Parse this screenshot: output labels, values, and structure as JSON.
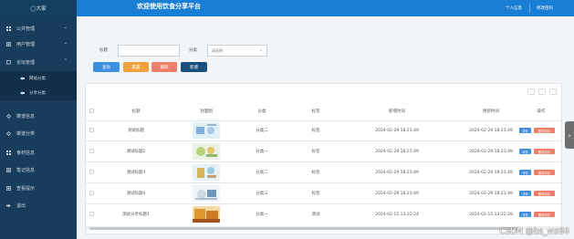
{
  "header": {
    "logo_text": "◯大家",
    "app_title": "欢迎使用饮食分享平台",
    "personal_info": "个人信息",
    "change_password": "修改密码"
  },
  "sidebar": {
    "items": [
      {
        "label": "公共管理",
        "icon": "grid-icon",
        "expanded": false
      },
      {
        "label": "用户管理",
        "icon": "user-icon",
        "expanded": false
      },
      {
        "label": "论坛管理",
        "icon": "forum-icon",
        "expanded": true
      },
      {
        "label": "菜谱信息",
        "icon": "recipe-icon",
        "expanded": false
      },
      {
        "label": "菜谱分类",
        "icon": "category-icon",
        "expanded": false
      },
      {
        "label": "食材信息",
        "icon": "food-icon",
        "expanded": false
      },
      {
        "label": "笔记信息",
        "icon": "note-icon",
        "expanded": false
      },
      {
        "label": "查看提示",
        "icon": "notice-icon",
        "expanded": false
      },
      {
        "label": "退出",
        "icon": "exit-icon",
        "expanded": false
      }
    ],
    "subitems": [
      {
        "label": "网站分类",
        "active": true
      },
      {
        "label": "分享分类",
        "active": false
      }
    ]
  },
  "search": {
    "title_label": "标题",
    "title_value": "",
    "category_label": "分类",
    "category_value": "请选择"
  },
  "actions": {
    "search": "查询",
    "reset": "重置",
    "delete": "删除",
    "add": "新增"
  },
  "table": {
    "columns": [
      "标题",
      "封面图",
      "分类",
      "标签",
      "新增时间",
      "更新时间",
      "操作"
    ],
    "rows": [
      {
        "title": "测试标题",
        "category": "分类二",
        "tag": "标签",
        "created": "2024-02-29 18:21:49",
        "updated": "2024-02-29 18:21:49",
        "edit": "详情",
        "del": "删除评论"
      },
      {
        "title": "测试标题2",
        "category": "分类一",
        "tag": "标签",
        "created": "2024-02-29 18:21:49",
        "updated": "2024-02-29 18:21:49",
        "edit": "详情",
        "del": "删除评论"
      },
      {
        "title": "测试标题3",
        "category": "分类二",
        "tag": "标签",
        "created": "2024-02-29 18:21:49",
        "updated": "2024-02-29 18:21:49",
        "edit": "详情",
        "del": "删除评论"
      },
      {
        "title": "测试标题4",
        "category": "分类三",
        "tag": "标签",
        "created": "2024-02-29 18:21:49",
        "updated": "2024-02-29 18:21:49",
        "edit": "详情",
        "del": "删除评论"
      },
      {
        "title": "测试分享标题1",
        "category": "分类一",
        "tag": "测试",
        "created": "2024-02-15 13:22:24",
        "updated": "2024-02-15 13:22:28",
        "edit": "详情",
        "del": "删除评论"
      }
    ]
  },
  "watermark": "CSDN @bs_wa66",
  "colors": {
    "topbar": "#1a7fd4",
    "sidebar": "#183c5c",
    "btn_search": "#3e8fe0",
    "btn_reset": "#f0a13e",
    "btn_delete": "#ef7e6a",
    "btn_add": "#1b4f7d",
    "btn_edit": "#3e8fe0",
    "btn_row_delete": "#ef7e6a"
  }
}
